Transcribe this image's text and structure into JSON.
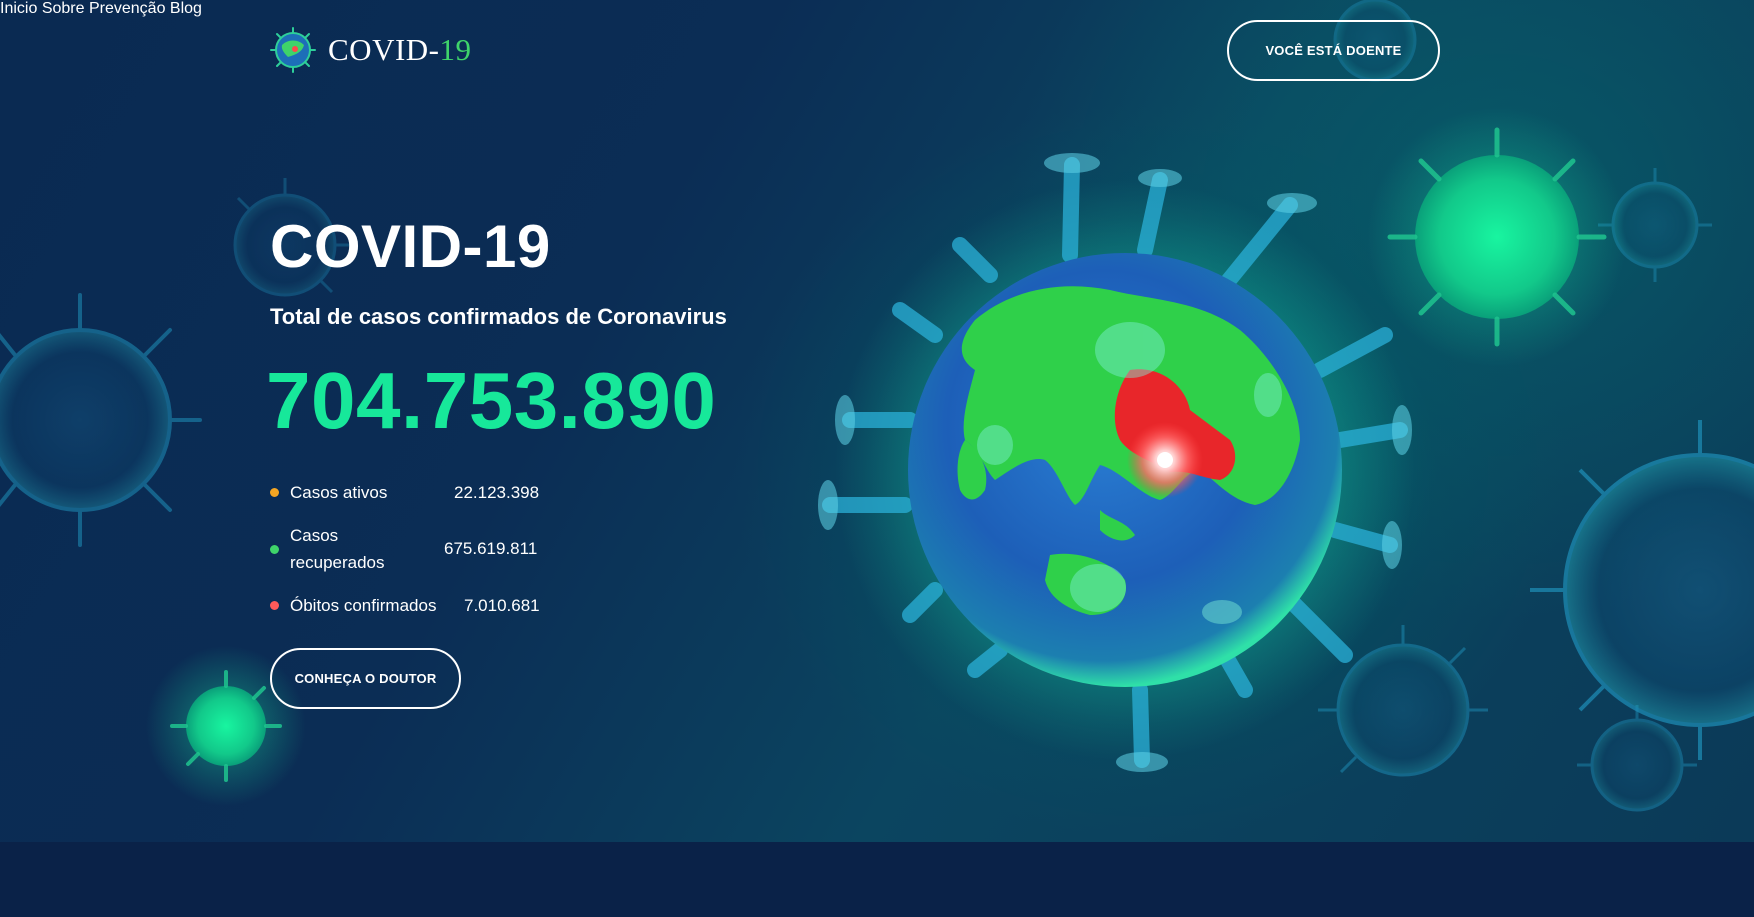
{
  "brand": {
    "name_main": "COVID-",
    "name_accent": "19"
  },
  "nav": {
    "items": [
      "Inicio",
      "Sobre",
      "Prevenção",
      "Blog"
    ],
    "cta_label": "VOCÊ ESTÁ DOENTE"
  },
  "hero": {
    "title": "COVID-19",
    "subtitle": "Total de casos confirmados de Coronavirus",
    "total_cases": "704.753.890",
    "stats": [
      {
        "label": "Casos ativos",
        "value": "22.123.398",
        "color": "#f5a623"
      },
      {
        "label": "Casos recuperados",
        "value": "675.619.811",
        "color": "#3fd46a"
      },
      {
        "label": "Óbitos confirmados",
        "value": "7.010.681",
        "color": "#ff5a5a"
      }
    ],
    "cta_label": "CONHEÇA O DOUTOR"
  },
  "colors": {
    "accent_green": "#17e89a",
    "background": "#0a2248",
    "logo_green": "#3fd46a"
  },
  "icons": [
    "virus-icon",
    "globe-virus-illustration"
  ]
}
